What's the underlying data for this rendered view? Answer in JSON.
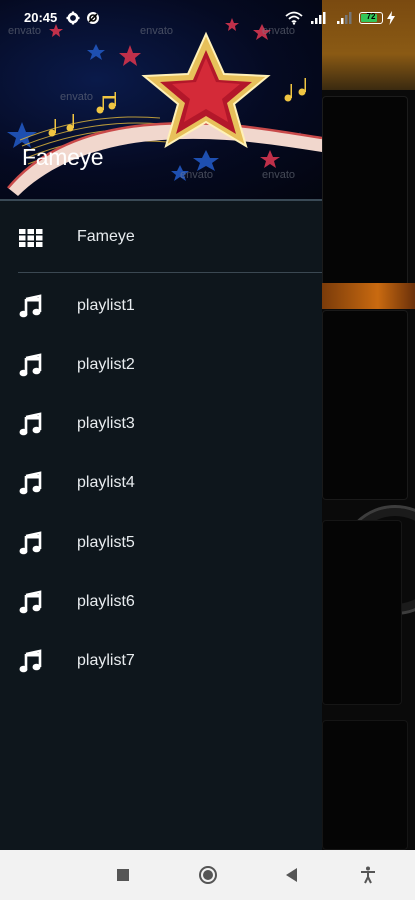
{
  "status_bar": {
    "time": "20:45",
    "battery_level": "72",
    "icons": [
      "gear-icon",
      "vpn-icon",
      "wifi-icon",
      "signal-icon",
      "signal-icon",
      "battery-icon",
      "charging-icon"
    ]
  },
  "drawer": {
    "title": "Fameye",
    "home_item": {
      "label": "Fameye",
      "icon": "grid-icon"
    },
    "playlists": [
      {
        "label": "playlist1",
        "icon": "music-note-icon"
      },
      {
        "label": "playlist2",
        "icon": "music-note-icon"
      },
      {
        "label": "playlist3",
        "icon": "music-note-icon"
      },
      {
        "label": "playlist4",
        "icon": "music-note-icon"
      },
      {
        "label": "playlist5",
        "icon": "music-note-icon"
      },
      {
        "label": "playlist6",
        "icon": "music-note-icon"
      },
      {
        "label": "playlist7",
        "icon": "music-note-icon"
      }
    ],
    "header_watermark": "envato"
  },
  "nav_bar": {
    "buttons": [
      "recents-icon",
      "home-icon",
      "back-icon",
      "accessibility-icon"
    ]
  },
  "colors": {
    "drawer_bg": "#0e161c",
    "nav_bg": "#f2f2f2",
    "battery": "#34c759"
  }
}
